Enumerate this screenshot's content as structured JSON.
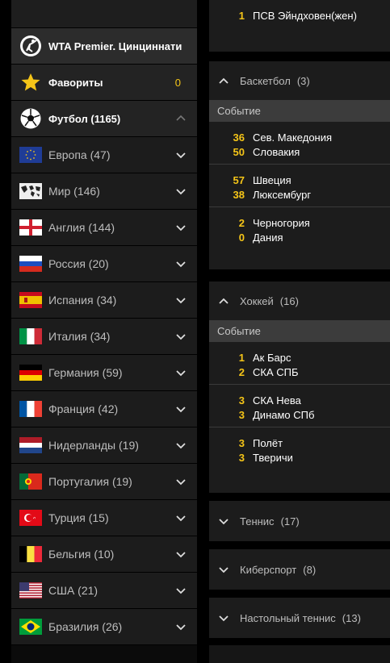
{
  "sidebar": {
    "items": [
      {
        "label": "WTA Premier. Цинциннати"
      },
      {
        "label": "Фавориты",
        "count": "0"
      },
      {
        "label": "Футбол (1165)"
      },
      {
        "label": "Европа (47)"
      },
      {
        "label": "Мир (146)"
      },
      {
        "label": "Англия (144)"
      },
      {
        "label": "Россия (20)"
      },
      {
        "label": "Испания (34)"
      },
      {
        "label": "Италия (34)"
      },
      {
        "label": "Германия (59)"
      },
      {
        "label": "Франция (42)"
      },
      {
        "label": "Нидерланды (19)"
      },
      {
        "label": "Португалия (19)"
      },
      {
        "label": "Турция (15)"
      },
      {
        "label": "Бельгия (10)"
      },
      {
        "label": "США (21)"
      },
      {
        "label": "Бразилия (26)"
      }
    ]
  },
  "top_partial": {
    "score": "1",
    "team": "ПСВ Эйндховен(жен)"
  },
  "basketball": {
    "name": "Баскетбол",
    "count": "(3)",
    "col_label": "Событие",
    "matches": [
      {
        "s1": "36",
        "t1": "Сев. Македония",
        "s2": "50",
        "t2": "Словакия"
      },
      {
        "s1": "57",
        "t1": "Швеция",
        "s2": "38",
        "t2": "Люксембург"
      },
      {
        "s1": "2",
        "t1": "Черногория",
        "s2": "0",
        "t2": "Дания"
      }
    ]
  },
  "hockey": {
    "name": "Хоккей",
    "count": "(16)",
    "col_label": "Событие",
    "matches": [
      {
        "s1": "1",
        "t1": "Ак Барс",
        "s2": "2",
        "t2": "СКА СПБ"
      },
      {
        "s1": "3",
        "t1": "СКА Нева",
        "s2": "3",
        "t2": "Динамо СПб"
      },
      {
        "s1": "3",
        "t1": "Полёт",
        "s2": "3",
        "t2": "Тверичи"
      }
    ]
  },
  "collapsed": [
    {
      "name": "Теннис",
      "count": "(17)"
    },
    {
      "name": "Киберспорт",
      "count": "(8)"
    },
    {
      "name": "Настольный теннис",
      "count": "(13)"
    }
  ],
  "colors": {
    "accent": "#f5c518",
    "panel": "#1c1c1c",
    "header": "#3c3c3c"
  }
}
